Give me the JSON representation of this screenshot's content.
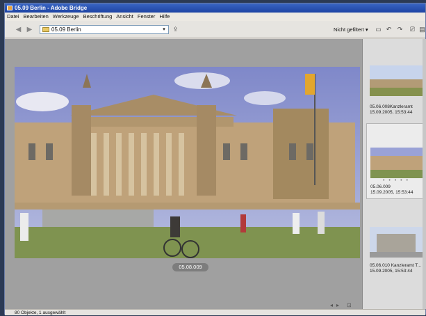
{
  "window": {
    "title": "05.09 Berlin - Adobe Bridge"
  },
  "menu": [
    "Datei",
    "Bearbeiten",
    "Werkzeuge",
    "Beschriftung",
    "Ansicht",
    "Fenster",
    "Hilfe"
  ],
  "toolbar": {
    "path": "05.09 Berlin",
    "filter": "Nicht gefiltert ▾"
  },
  "preview": {
    "caption": "05.08.009"
  },
  "thumbnails": [
    {
      "name": "05.06.008Kanzleramt",
      "date": "15.09.2005, 15:53:44"
    },
    {
      "name": "05.06.009",
      "date": "15.09.2005, 15:53:44",
      "dots": "• • • • •"
    },
    {
      "name": "05.06.010 Kanzleramt T...",
      "date": "15.09.2005, 15:53:44"
    }
  ],
  "status": {
    "count": "80 Objekte, 1 ausgewählt"
  }
}
